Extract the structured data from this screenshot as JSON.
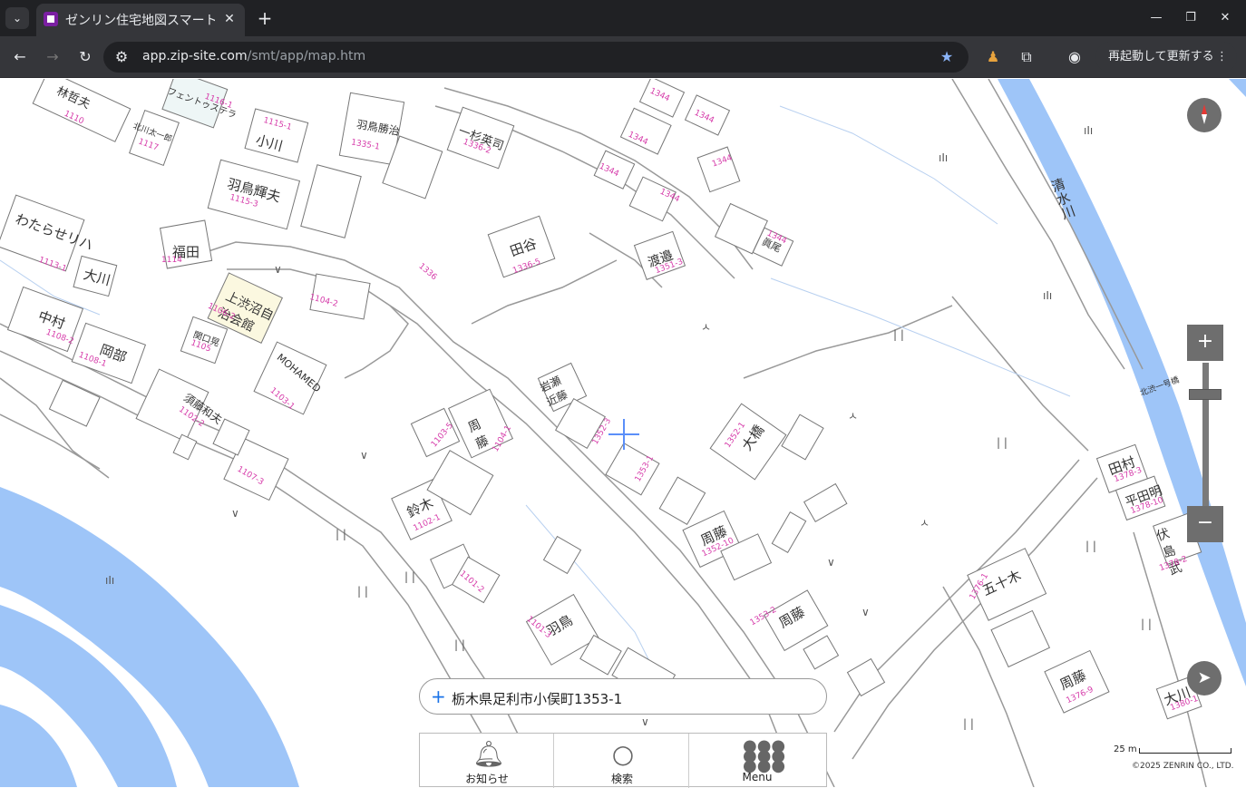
{
  "browser": {
    "tab_title": "ゼンリン住宅地図スマート",
    "tab_close": "✕",
    "new_tab": "+",
    "url_host": "app.zip-site.com",
    "url_path": "/smt/app/map.htm",
    "restart_label": "再起動して更新する"
  },
  "map": {
    "river_label": "清水川",
    "buildings": [
      {
        "name": "林哲夫",
        "num": "1110"
      },
      {
        "name": "フェントゥステラ",
        "num": "1116-1"
      },
      {
        "name": "北川太一郎",
        "num": "1117"
      },
      {
        "name": "小川",
        "num": "1115-1"
      },
      {
        "name": "羽鳥勝治",
        "num": "1335-1"
      },
      {
        "name": "一杉英司",
        "num": "1336-2"
      },
      {
        "name": "羽鳥輝夫",
        "num": "1115-3"
      },
      {
        "name": "わたらせリハ",
        "num": "1113-1"
      },
      {
        "name": "福田",
        "num": "1114"
      },
      {
        "name": "大川",
        "num": ""
      },
      {
        "name": "田谷",
        "num": "1336-5"
      },
      {
        "name": "渡邉",
        "num": "1351-3"
      },
      {
        "name": "上渋沼自治会館",
        "num": "1106-2"
      },
      {
        "name": "中村",
        "num": "1108-2"
      },
      {
        "name": "岡部",
        "num": "1108-1"
      },
      {
        "name": "関口晃",
        "num": "1105"
      },
      {
        "name": "MOHAMED",
        "num": "1103-1"
      },
      {
        "name": "岩瀬近藤",
        "num": ""
      },
      {
        "name": "周藤",
        "num": "1104-1"
      },
      {
        "name": "大橋",
        "num": "1352-1"
      },
      {
        "name": "須藤和夫",
        "num": "1102-2"
      },
      {
        "name": "鈴木",
        "num": "1102-1"
      },
      {
        "name": "周藤",
        "num": "1352-10"
      },
      {
        "name": "羽鳥",
        "num": "1101-3"
      },
      {
        "name": "周藤",
        "num": "1353-2"
      },
      {
        "name": "五十木",
        "num": "1376-1"
      },
      {
        "name": "田村",
        "num": "1378-3"
      },
      {
        "name": "平田明",
        "num": "1378-10"
      },
      {
        "name": "伏島武",
        "num": "1378-2"
      },
      {
        "name": "周藤",
        "num": "1376-9"
      },
      {
        "name": "大川",
        "num": "1380-1"
      },
      {
        "name": "眞尾",
        "num": "1344"
      }
    ],
    "parcel_numbers": [
      "1344",
      "1344",
      "1344",
      "1344",
      "1344",
      "1344",
      "1336",
      "1104-2",
      "1107-3",
      "1103-5",
      "1101-2",
      "1352-3",
      "1353-1"
    ],
    "bridge_label": "北渋一号橋"
  },
  "controls": {
    "zoom_in": "+",
    "zoom_out": "−",
    "locate_icon": "➤"
  },
  "address_bar": {
    "plus": "+",
    "text": "栃木県足利市小俣町1353-1"
  },
  "bottom_nav": [
    {
      "label": "お知らせ",
      "icon": "bell-icon"
    },
    {
      "label": "検索",
      "icon": "search-icon"
    },
    {
      "label": "Menu",
      "icon": "grid-icon"
    }
  ],
  "scale": {
    "label": "25 m"
  },
  "copyright": "©2025 ZENRIN CO., LTD."
}
